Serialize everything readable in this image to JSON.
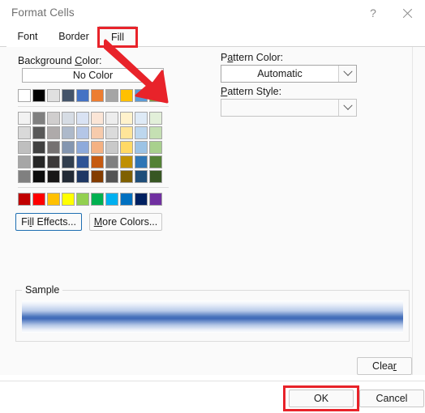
{
  "window": {
    "title": "Format Cells",
    "help_icon": "question-mark-icon",
    "help_glyph": "?",
    "close_icon": "close-icon"
  },
  "tabs": [
    {
      "label": "Font",
      "selected": false
    },
    {
      "label": "Border",
      "selected": false
    },
    {
      "label": "Fill",
      "selected": true
    }
  ],
  "fill_panel": {
    "background_color_label": "Background Color:",
    "background_color_label_pre": "Background ",
    "background_color_label_key": "C",
    "background_color_label_post": "olor:",
    "no_color_button": "No Color",
    "pattern_color_label_pre": "P",
    "pattern_color_label_key": "a",
    "pattern_color_label_post": "ttern Color:",
    "pattern_color_value": "Automatic",
    "pattern_style_label_pre": "",
    "pattern_style_label_key": "P",
    "pattern_style_label_post": "attern Style:",
    "pattern_style_value": "",
    "fill_effects_button_pre": "Fi",
    "fill_effects_button_key": "l",
    "fill_effects_button_post": "l Effects...",
    "more_colors_button_pre": "",
    "more_colors_button_key": "M",
    "more_colors_button_post": "ore Colors...",
    "dropdown_icon": "chevron-down-icon"
  },
  "palette": {
    "top_row": [
      "#ffffff",
      "#000000",
      "#e0e0e0",
      "#44546a",
      "#4472c4",
      "#ed7d31",
      "#a5a5a5",
      "#ffc000",
      "#5b9bd5",
      "#70ad47"
    ],
    "theme_rows": [
      [
        "#f2f2f2",
        "#808080",
        "#d0cece",
        "#d6dce4",
        "#d9e2f3",
        "#fbe5d6",
        "#ededed",
        "#fff2cc",
        "#deeaf6",
        "#e2efd9"
      ],
      [
        "#d9d9d9",
        "#595959",
        "#aeaaaa",
        "#adb9ca",
        "#b4c6e7",
        "#f7cbac",
        "#dbdbdb",
        "#ffe599",
        "#bdd7ee",
        "#c5e0b3"
      ],
      [
        "#bfbfbf",
        "#404040",
        "#757171",
        "#8496b0",
        "#8eaadb",
        "#f4b183",
        "#c9c9c9",
        "#ffd965",
        "#9cc3e5",
        "#a8d08d"
      ],
      [
        "#a6a6a6",
        "#262626",
        "#3b3838",
        "#323f4f",
        "#2f5496",
        "#c55a11",
        "#808080",
        "#bf8f00",
        "#2e75b5",
        "#538135"
      ],
      [
        "#808080",
        "#0d0d0d",
        "#181717",
        "#222a35",
        "#1f3864",
        "#833c00",
        "#545454",
        "#7f6000",
        "#1f4e79",
        "#375623"
      ]
    ],
    "standard_row": [
      "#c00000",
      "#ff0000",
      "#ffc000",
      "#ffff00",
      "#92d050",
      "#00b050",
      "#00b0f0",
      "#0070c0",
      "#002060",
      "#7030a0"
    ],
    "selected_swatch_index": 8,
    "selected_swatch_color": "#5b9bd5"
  },
  "sample": {
    "group_title": "Sample",
    "gradient_description": "white-to-blue-to-white vertical gradient",
    "gradient_mid_color": "#4a74bd",
    "gradient_edge_color": "#ffffff"
  },
  "footer": {
    "clear_button_pre": "Clea",
    "clear_button_key": "r",
    "clear_button_post": "",
    "ok_button": "OK",
    "cancel_button": "Cancel"
  },
  "annotations": {
    "highlight_color": "#e8232a",
    "boxes": [
      {
        "target": "Fill tab"
      },
      {
        "target": "OK button"
      }
    ],
    "arrow": {
      "from": "Fill tab",
      "to": "light blue swatch"
    }
  }
}
